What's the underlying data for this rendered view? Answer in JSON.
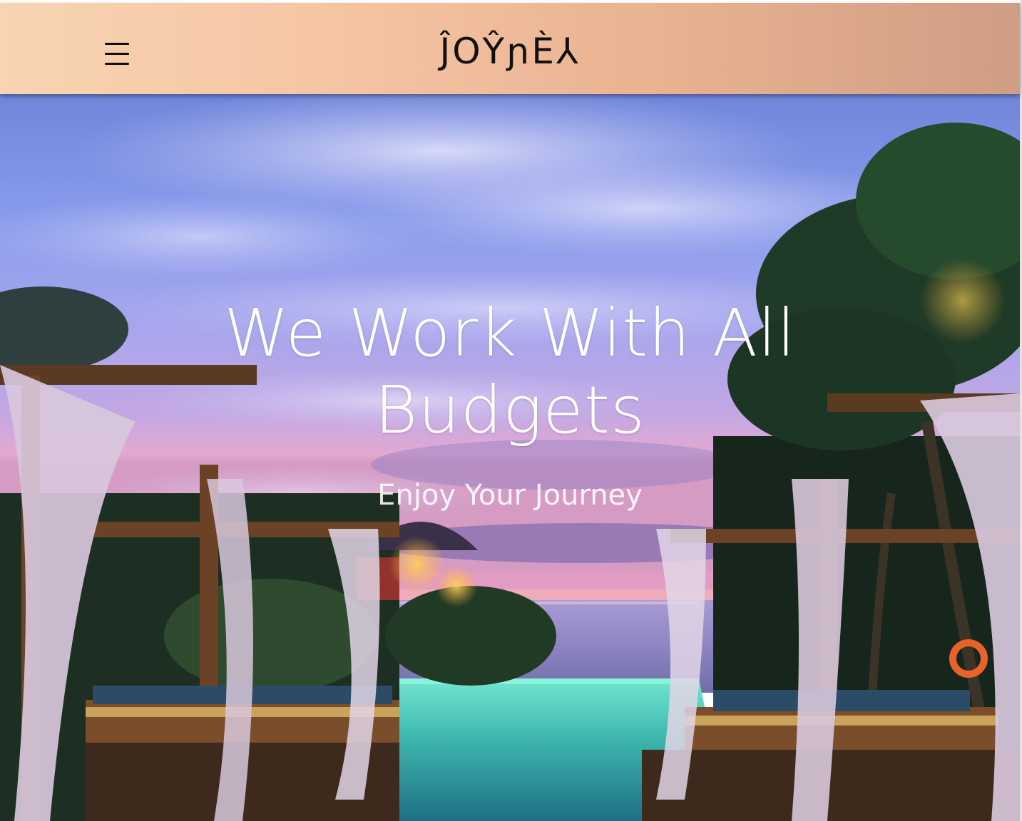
{
  "header": {
    "menu_icon": "hamburger-menu-icon",
    "logo_text": "ĴOŶɲÈ⅄"
  },
  "hero": {
    "title": "We Work With All Budgets",
    "subtitle": "Enjoy Your Journey"
  },
  "colors": {
    "header_gradient_start": "#f8d4b2",
    "header_gradient_end": "#cf9d84",
    "hero_text": "#ffffff"
  }
}
